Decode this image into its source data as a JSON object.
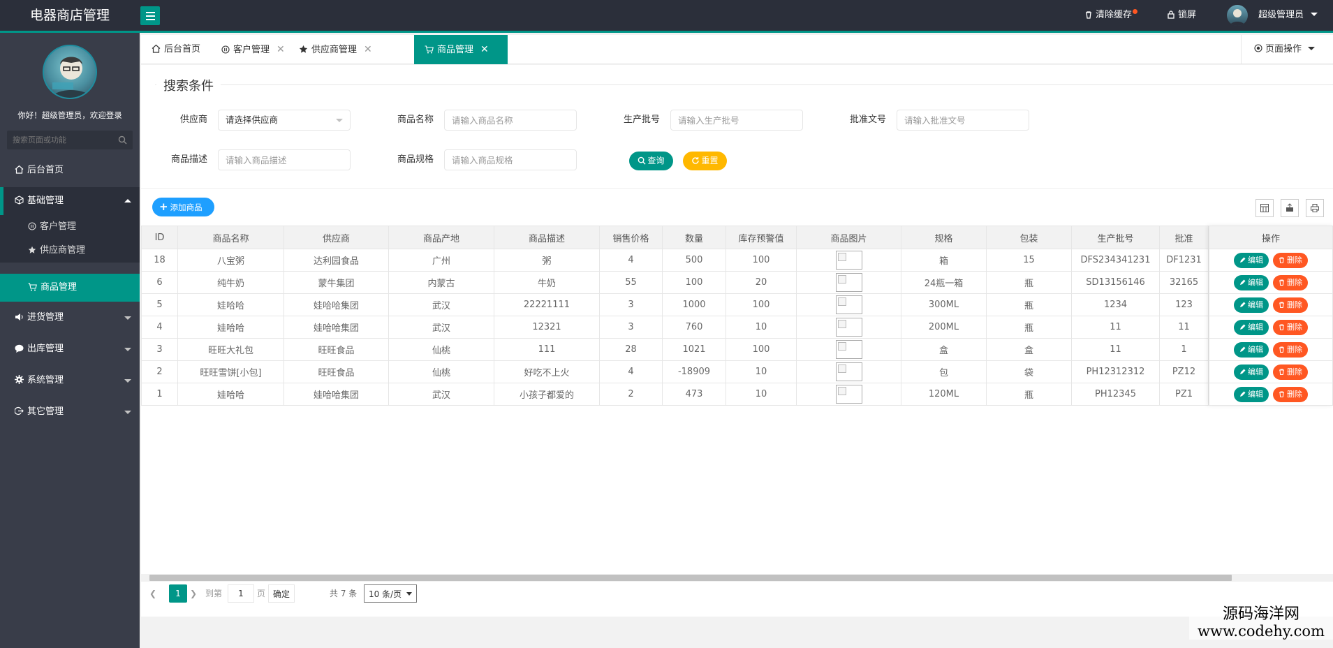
{
  "app": {
    "title": "电器商店管理"
  },
  "topbar": {
    "clear_cache": "清除缓存",
    "lock": "锁屏",
    "user": "超级管理员"
  },
  "sidebar": {
    "welcome": "你好！超级管理员，欢迎登录",
    "search_placeholder": "搜索页面或功能",
    "items": [
      {
        "label": "后台首页"
      },
      {
        "label": "基础管理",
        "children": [
          {
            "label": "客户管理"
          },
          {
            "label": "供应商管理"
          },
          {
            "label": "商品管理"
          }
        ]
      },
      {
        "label": "进货管理"
      },
      {
        "label": "出库管理"
      },
      {
        "label": "系统管理"
      },
      {
        "label": "其它管理"
      }
    ]
  },
  "tabs": [
    {
      "label": "后台首页"
    },
    {
      "label": "客户管理"
    },
    {
      "label": "供应商管理"
    },
    {
      "label": "商品管理"
    }
  ],
  "page_ops": "页面操作",
  "search": {
    "legend": "搜索条件",
    "supplier_label": "供应商",
    "supplier_value": "请选择供应商",
    "name_label": "商品名称",
    "name_placeholder": "请输入商品名称",
    "batch_label": "生产批号",
    "batch_placeholder": "请输入生产批号",
    "approval_label": "批准文号",
    "approval_placeholder": "请输入批准文号",
    "desc_label": "商品描述",
    "desc_placeholder": "请输入商品描述",
    "spec_label": "商品规格",
    "spec_placeholder": "请输入商品规格",
    "query_btn": "查询",
    "reset_btn": "重置"
  },
  "toolbar": {
    "add_btn": "添加商品"
  },
  "table": {
    "columns": [
      "ID",
      "商品名称",
      "供应商",
      "商品产地",
      "商品描述",
      "销售价格",
      "数量",
      "库存预警值",
      "商品图片",
      "规格",
      "包装",
      "生产批号",
      "批准"
    ],
    "ops_header": "操作",
    "edit_label": "编辑",
    "delete_label": "删除",
    "rows": [
      [
        "18",
        "八宝粥",
        "达利园食品",
        "广州",
        "粥",
        "4",
        "500",
        "100",
        "",
        "箱",
        "15",
        "DFS234341231",
        "DF1231"
      ],
      [
        "6",
        "纯牛奶",
        "蒙牛集团",
        "内蒙古",
        "牛奶",
        "55",
        "100",
        "20",
        "",
        "24瓶一箱",
        "瓶",
        "SD13156146",
        "32165"
      ],
      [
        "5",
        "娃哈哈",
        "娃哈哈集团",
        "武汉",
        "22221111",
        "3",
        "1000",
        "100",
        "",
        "300ML",
        "瓶",
        "1234",
        "123"
      ],
      [
        "4",
        "娃哈哈",
        "娃哈哈集团",
        "武汉",
        "12321",
        "3",
        "760",
        "10",
        "",
        "200ML",
        "瓶",
        "11",
        "11"
      ],
      [
        "3",
        "旺旺大礼包",
        "旺旺食品",
        "仙桃",
        "111",
        "28",
        "1021",
        "100",
        "",
        "盒",
        "盒",
        "11",
        "1"
      ],
      [
        "2",
        "旺旺雪饼[小包]",
        "旺旺食品",
        "仙桃",
        "好吃不上火",
        "4",
        "-18909",
        "10",
        "",
        "包",
        "袋",
        "PH12312312",
        "PZ12"
      ],
      [
        "1",
        "娃哈哈",
        "娃哈哈集团",
        "武汉",
        "小孩子都爱的",
        "2",
        "473",
        "10",
        "",
        "120ML",
        "瓶",
        "PH12345",
        "PZ1"
      ]
    ]
  },
  "pager": {
    "current": "1",
    "goto": "到第",
    "page_input": "1",
    "page_unit": "页",
    "ok": "确定",
    "total": "共 7 条",
    "size": "10 条/页"
  },
  "watermark": {
    "line1": "源码海洋网",
    "line2": "www.codehy.com"
  }
}
